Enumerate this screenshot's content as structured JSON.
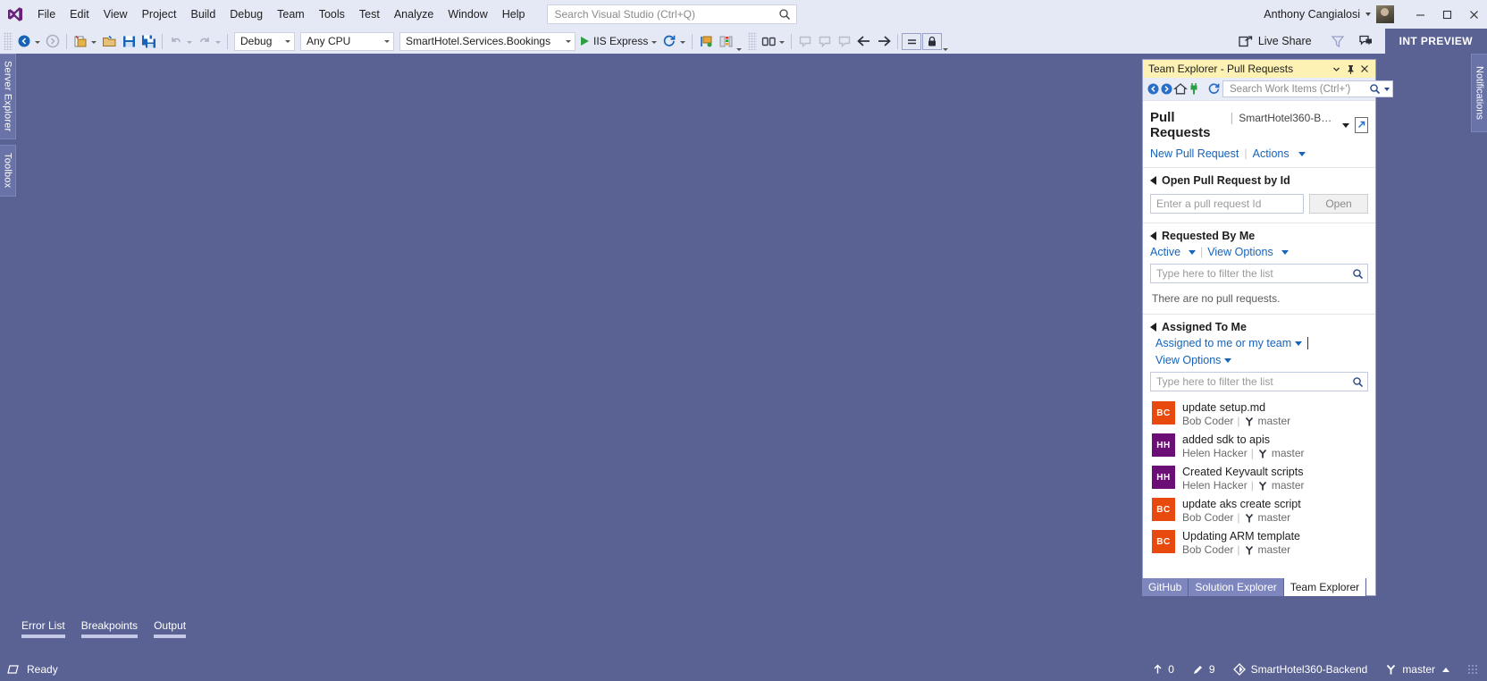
{
  "app": {
    "title": "Visual Studio",
    "logo_icon": "visual-studio-logo"
  },
  "menu": {
    "items": [
      {
        "label": "File"
      },
      {
        "label": "Edit"
      },
      {
        "label": "View"
      },
      {
        "label": "Project"
      },
      {
        "label": "Build"
      },
      {
        "label": "Debug"
      },
      {
        "label": "Team"
      },
      {
        "label": "Tools"
      },
      {
        "label": "Test"
      },
      {
        "label": "Analyze"
      },
      {
        "label": "Window"
      },
      {
        "label": "Help"
      }
    ]
  },
  "search": {
    "placeholder": "Search Visual Studio (Ctrl+Q)",
    "value": "",
    "icon": "search-icon"
  },
  "account": {
    "name": "Anthony Cangialosi",
    "avatar_icon": "user-avatar",
    "dropdown_icon": "chevron-down-icon"
  },
  "window_controls": {
    "minimize": "—",
    "maximize": "☐",
    "close": "✕"
  },
  "toolbar": {
    "navigate_back_icon": "navigate-back-icon",
    "navigate_forward_icon": "navigate-forward-icon",
    "new_project_icon": "new-project-icon",
    "open_file_icon": "open-file-icon",
    "save_icon": "save-icon",
    "save_all_icon": "save-all-icon",
    "undo_icon": "undo-icon",
    "redo_icon": "redo-icon",
    "config_value": "Debug",
    "platform_value": "Any CPU",
    "startup_project_value": "SmartHotel.Services.Bookings",
    "run_label": "IIS Express",
    "run_icon": "play-icon",
    "refresh_icon": "refresh-icon",
    "attach_icon": "attach-to-process-icon",
    "layout_icon": "window-layout-icon",
    "columns_icon": "columns-icon",
    "comment_icon": "comment-icon",
    "uncomment_icon": "uncomment-icon",
    "bookmark_icon": "bookmark-icon",
    "nav_back_icon": "arrow-left-icon",
    "nav_fwd_icon": "arrow-right-icon",
    "indent_icon": "indent-icon",
    "lock_icon": "lock-icon",
    "live_share_label": "Live Share",
    "live_share_icon": "live-share-icon",
    "funnel_icon": "funnel-icon",
    "feedback_icon": "feedback-icon",
    "branch_badge": "INT PREVIEW"
  },
  "left_dock": {
    "tabs": [
      {
        "label": "Server Explorer"
      },
      {
        "label": "Toolbox"
      }
    ]
  },
  "right_dock": {
    "tabs": [
      {
        "label": "Notifications"
      }
    ]
  },
  "bottom_dock": {
    "tabs": [
      {
        "label": "Error List"
      },
      {
        "label": "Breakpoints"
      },
      {
        "label": "Output"
      }
    ]
  },
  "team_explorer": {
    "window_title": "Team Explorer - Pull Requests",
    "titlebar_controls": {
      "dropdown_icon": "chevron-down-icon",
      "pin_icon": "pin-icon",
      "close_icon": "close-icon"
    },
    "toolbar": {
      "back_icon": "back-icon",
      "forward_icon": "forward-icon",
      "home_icon": "home-icon",
      "connect_icon": "connect-plug-icon",
      "refresh_icon": "refresh-icon",
      "search_placeholder": "Search Work Items (Ctrl+')",
      "search_value": "",
      "search_icon": "search-icon",
      "search_dropdown_icon": "chevron-down-icon"
    },
    "page_title": "Pull Requests",
    "repository": "SmartHotel360-Backe...",
    "repo_dropdown_icon": "chevron-down-icon",
    "popout_icon": "open-in-new-window-icon",
    "links": {
      "new_pull_request": "New Pull Request",
      "actions": "Actions"
    },
    "sections": [
      {
        "id": "open-by-id",
        "title": "Open Pull Request by Id",
        "expanded": true,
        "input_placeholder": "Enter a pull request Id",
        "input_value": "",
        "button_label": "Open"
      },
      {
        "id": "requested-by-me",
        "title": "Requested By Me",
        "expanded": true,
        "filter_label": "Active",
        "view_options_label": "View Options",
        "filter_placeholder": "Type here to filter the list",
        "filter_value": "",
        "empty_message": "There are no pull requests.",
        "items": []
      },
      {
        "id": "assigned-to-me",
        "title": "Assigned To Me",
        "expanded": true,
        "filter_label": "Assigned to me or my team",
        "view_options_label": "View Options",
        "filter_placeholder": "Type here to filter the list",
        "filter_value": "",
        "empty_message": "",
        "items": [
          {
            "title": "update setup.md",
            "author": "Bob Coder",
            "branch": "master",
            "initials": "BC",
            "avatar_color": "#e8490f",
            "branch_icon": "git-branch-icon"
          },
          {
            "title": "added sdk to apis",
            "author": "Helen Hacker",
            "branch": "master",
            "initials": "HH",
            "avatar_color": "#6b0f77",
            "branch_icon": "git-branch-icon"
          },
          {
            "title": "Created Keyvault scripts",
            "author": "Helen Hacker",
            "branch": "master",
            "initials": "HH",
            "avatar_color": "#6b0f77",
            "branch_icon": "git-branch-icon"
          },
          {
            "title": "update aks create script",
            "author": "Bob Coder",
            "branch": "master",
            "initials": "BC",
            "avatar_color": "#e8490f",
            "branch_icon": "git-branch-icon"
          },
          {
            "title": "Updating ARM template",
            "author": "Bob Coder",
            "branch": "master",
            "initials": "BC",
            "avatar_color": "#e8490f",
            "branch_icon": "git-branch-icon"
          }
        ]
      }
    ],
    "bottom_tabs": [
      {
        "label": "GitHub",
        "active": false
      },
      {
        "label": "Solution Explorer",
        "active": false
      },
      {
        "label": "Team Explorer",
        "active": true
      }
    ]
  },
  "status_bar": {
    "ready_text": "Ready",
    "ready_icon": "status-ready-icon",
    "unpublished_changes_count": "0",
    "unpublished_icon": "arrow-up-icon",
    "pending_changes_count": "9",
    "pending_icon": "pencil-icon",
    "repository": "SmartHotel360-Backend",
    "repository_icon": "source-control-icon",
    "branch": "master",
    "branch_icon": "git-branch-icon",
    "branch_dropdown_icon": "chevron-up-icon"
  },
  "colors": {
    "chrome": "#e4e9f5",
    "workspace": "#5a6294",
    "accent_link": "#1763b8",
    "panel_title": "#fdf2b3",
    "badge": "#5a6294"
  }
}
